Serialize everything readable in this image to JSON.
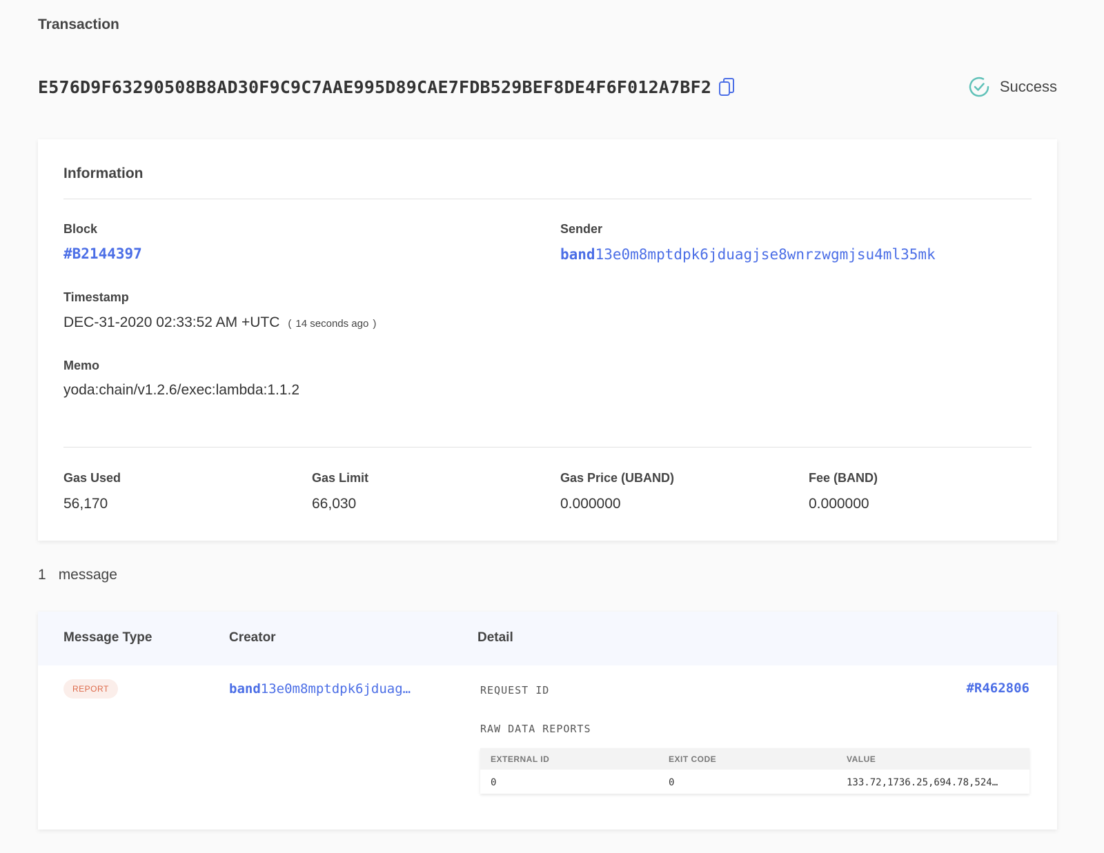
{
  "page_label": "Transaction",
  "tx": {
    "hash": "E576D9F63290508B8AD30F9C9C7AAE995D89CAE7FDB529BEF8DE4F6F012A7BF2",
    "status": "Success"
  },
  "colors": {
    "link": "#4b6ee6",
    "success": "#5fc1b8",
    "badge_text": "#dd6a4a",
    "badge_bg": "#fbeeea"
  },
  "icons": {
    "copy": "copy-icon",
    "status": "check-circle-icon"
  },
  "info": {
    "title": "Information",
    "block_label": "Block",
    "block_value": "#B2144397",
    "sender_label": "Sender",
    "sender_prefix": "band",
    "sender_rest": "13e0m8mptdpk6jduagjse8wnrzwgmjsu4ml35mk",
    "timestamp_label": "Timestamp",
    "timestamp_value": "DEC-31-2020 02:33:52 AM +UTC",
    "timestamp_ago_open": "(",
    "timestamp_ago": "14 seconds ago",
    "timestamp_ago_close": ")",
    "memo_label": "Memo",
    "memo_value": "yoda:chain/v1.2.6/exec:lambda:1.1.2",
    "gas_used_label": "Gas Used",
    "gas_used_value": "56,170",
    "gas_limit_label": "Gas Limit",
    "gas_limit_value": "66,030",
    "gas_price_label": "Gas Price (UBAND)",
    "gas_price_value": "0.000000",
    "fee_label": "Fee (BAND)",
    "fee_value": "0.000000"
  },
  "messages": {
    "count": "1",
    "count_label": "message",
    "headers": {
      "type": "Message Type",
      "creator": "Creator",
      "detail": "Detail"
    },
    "rows": [
      {
        "type": "REPORT",
        "creator_prefix": "band",
        "creator_rest": "13e0m8mptdpk6jduag…",
        "request_id_label": "REQUEST ID",
        "request_id": "#R462806",
        "raw_label": "RAW DATA REPORTS",
        "raw_headers": [
          "EXTERNAL ID",
          "EXIT CODE",
          "VALUE"
        ],
        "raw_rows": [
          [
            "0",
            "0",
            "133.72,1736.25,694.78,524…"
          ]
        ]
      }
    ]
  }
}
